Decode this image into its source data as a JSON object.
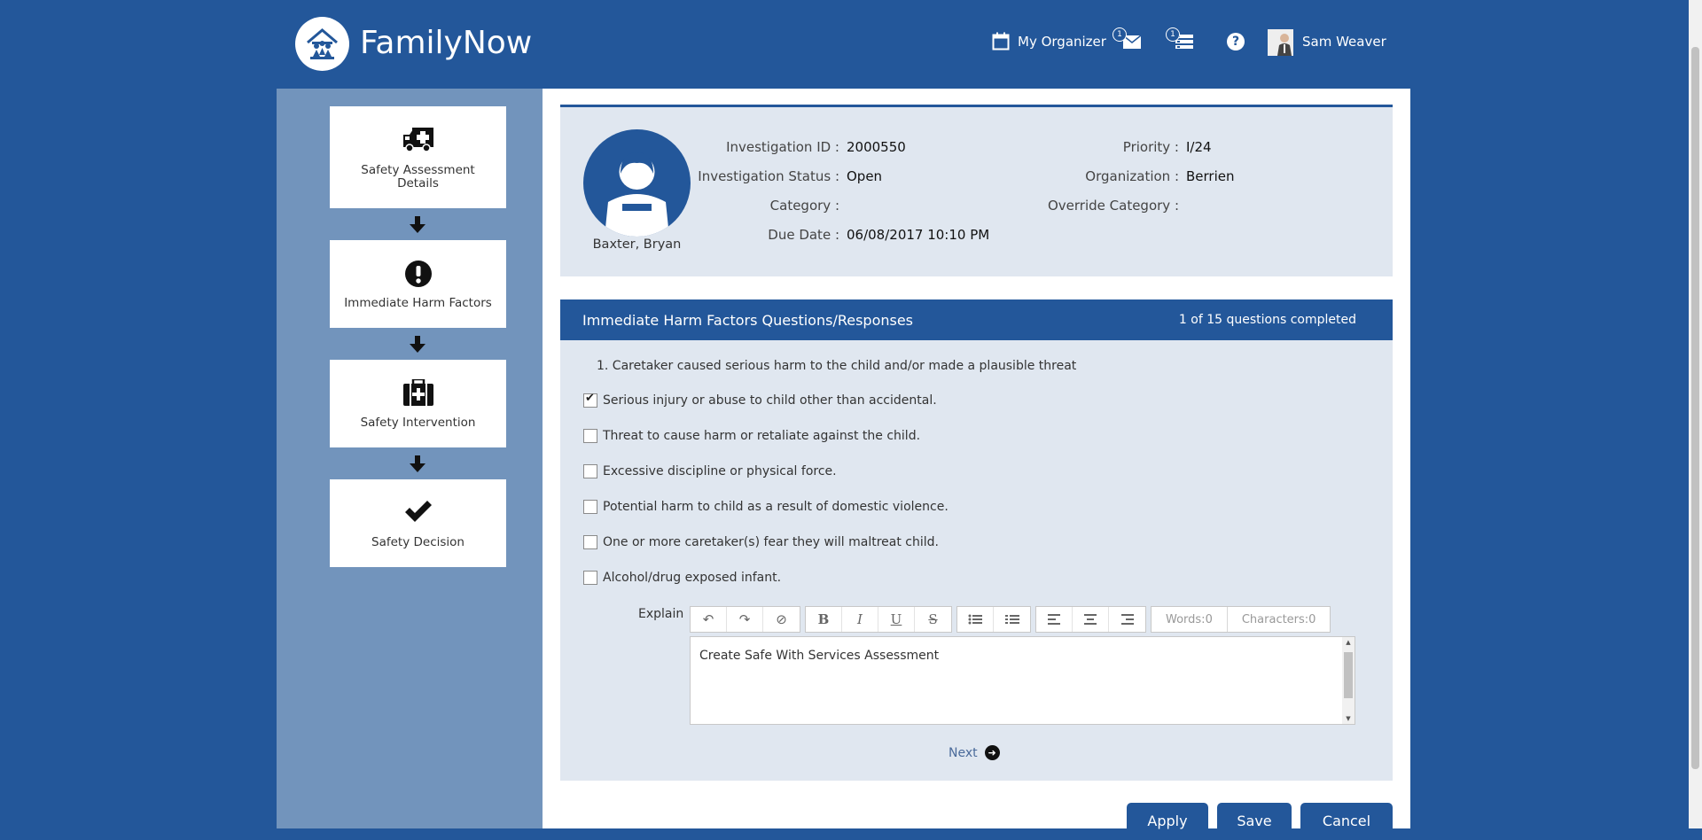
{
  "app": {
    "name": "FamilyNow"
  },
  "header": {
    "organizer_label": "My Organizer",
    "mail_badge": "1",
    "tasks_badge": "1",
    "help_label": "?",
    "user_name": "Sam Weaver"
  },
  "steps": [
    {
      "label": "Safety Assessment Details",
      "icon": "ambulance-icon"
    },
    {
      "label": "Immediate Harm Factors",
      "icon": "exclamation-icon"
    },
    {
      "label": "Safety Intervention",
      "icon": "medical-kit-icon"
    },
    {
      "label": "Safety Decision",
      "icon": "checkmark-icon"
    }
  ],
  "investigation": {
    "person_name": "Baxter, Bryan",
    "id_label": "Investigation ID :",
    "id_value": "2000550",
    "status_label": "Investigation Status :",
    "status_value": "Open",
    "category_label": "Category :",
    "category_value": "",
    "due_label": "Due Date :",
    "due_value": "06/08/2017 10:10 PM",
    "priority_label": "Priority :",
    "priority_value": "I/24",
    "org_label": "Organization :",
    "org_value": "Berrien",
    "override_label": "Override Category :",
    "override_value": ""
  },
  "questions": {
    "title": "Immediate Harm Factors Questions/Responses",
    "progress": "1 of 15 questions completed",
    "question_text": "1. Caretaker caused serious harm to the child and/or made a plausible threat",
    "options": [
      {
        "label": "Serious injury or abuse to child other than accidental.",
        "checked": true
      },
      {
        "label": "Threat to cause harm or retaliate against the child.",
        "checked": false
      },
      {
        "label": "Excessive discipline or physical force.",
        "checked": false
      },
      {
        "label": "Potential harm to child as a result of domestic violence.",
        "checked": false
      },
      {
        "label": "One or more caretaker(s) fear they will maltreat child.",
        "checked": false
      },
      {
        "label": "Alcohol/drug exposed infant.",
        "checked": false
      }
    ],
    "explain_label": "Explain",
    "editor": {
      "words": "Words:0",
      "characters": "Characters:0",
      "text": "Create Safe With Services Assessment",
      "bold_glyph": "B",
      "italic_glyph": "I",
      "underline_glyph": "U",
      "strike_glyph": "S"
    },
    "next_label": "Next"
  },
  "actions": {
    "apply": "Apply",
    "save": "Save",
    "cancel": "Cancel"
  }
}
